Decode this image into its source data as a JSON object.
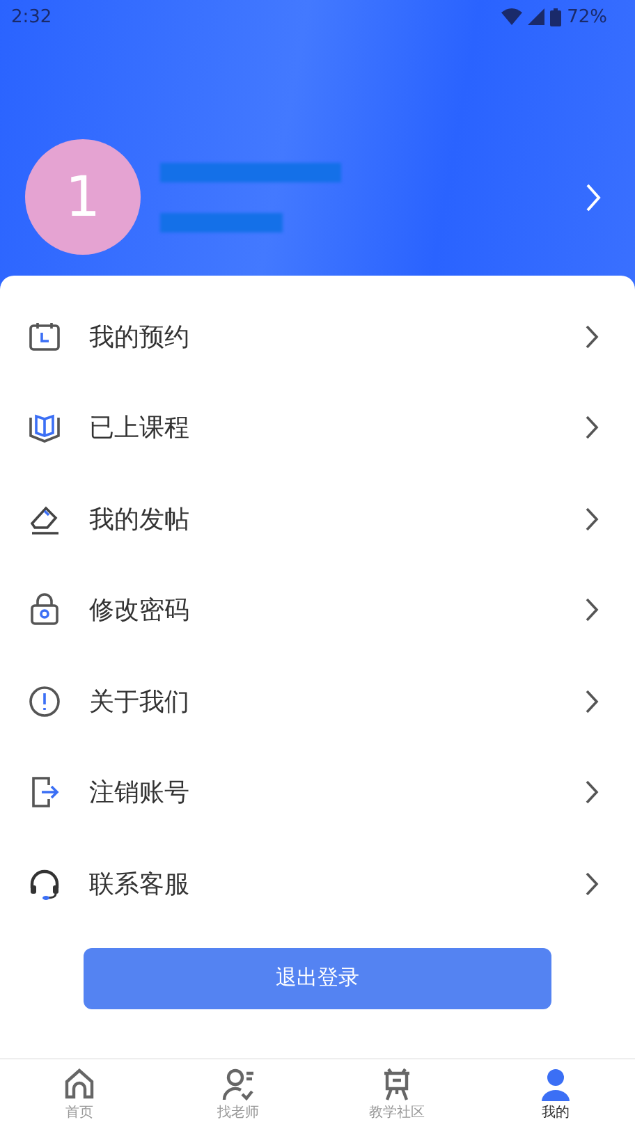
{
  "status_bar": {
    "time": "2:32",
    "battery": "72%"
  },
  "profile": {
    "avatar_letter": "1"
  },
  "menu": [
    {
      "label": "我的预约"
    },
    {
      "label": "已上课程"
    },
    {
      "label": "我的发帖"
    },
    {
      "label": "修改密码"
    },
    {
      "label": "关于我们"
    },
    {
      "label": "注销账号"
    },
    {
      "label": "联系客服"
    }
  ],
  "logout_button": "退出登录",
  "tabs": [
    {
      "label": "首页",
      "selected": false
    },
    {
      "label": "找老师",
      "selected": false
    },
    {
      "label": "教学社区",
      "selected": false
    },
    {
      "label": "我的",
      "selected": true
    }
  ]
}
